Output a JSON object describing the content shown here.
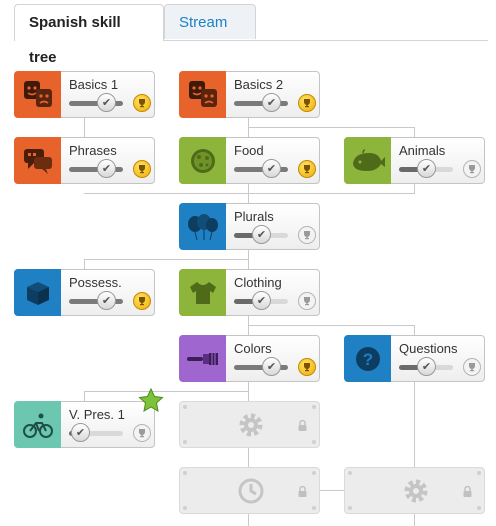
{
  "tabs": {
    "skill_tree": "Spanish skill tree",
    "stream": "Stream"
  },
  "colors": {
    "orange": "#e8632b",
    "green": "#8db53c",
    "blue": "#1f80c4",
    "purple": "#9f66cf",
    "teal": "#6bc7b0",
    "gold": "#f0ad00"
  },
  "skills": {
    "basics1": {
      "label": "Basics 1",
      "icon": "comedy-tragedy-masks-icon",
      "color": "orange",
      "progress": 1.0,
      "trophy": "gold"
    },
    "basics2": {
      "label": "Basics 2",
      "icon": "comedy-tragedy-masks-icon",
      "color": "orange",
      "progress": 1.0,
      "trophy": "gold"
    },
    "phrases": {
      "label": "Phrases",
      "icon": "speech-bubbles-icon",
      "color": "orange",
      "progress": 1.0,
      "trophy": "gold"
    },
    "food": {
      "label": "Food",
      "icon": "pizza-icon",
      "color": "green",
      "progress": 1.0,
      "trophy": "gold"
    },
    "animals": {
      "label": "Animals",
      "icon": "whale-icon",
      "color": "green",
      "progress": 0.55,
      "trophy": "grey"
    },
    "plurals": {
      "label": "Plurals",
      "icon": "balloons-icon",
      "color": "blue",
      "progress": 0.55,
      "trophy": "grey"
    },
    "possess": {
      "label": "Possess.",
      "icon": "box-icon",
      "color": "blue",
      "progress": 1.0,
      "trophy": "gold"
    },
    "clothing": {
      "label": "Clothing",
      "icon": "shirt-icon",
      "color": "green",
      "progress": 0.55,
      "trophy": "grey"
    },
    "colors": {
      "label": "Colors",
      "icon": "paintbrush-icon",
      "color": "purple",
      "progress": 1.0,
      "trophy": "gold"
    },
    "questions": {
      "label": "Questions",
      "icon": "question-mark-icon",
      "color": "blue",
      "progress": 0.55,
      "trophy": "grey"
    },
    "vpres1": {
      "label": "V. Pres. 1",
      "icon": "cyclist-icon",
      "color": "teal",
      "progress": 0.1,
      "trophy": "grey"
    }
  },
  "locked_skills": [
    {
      "icon": "gear-icon"
    },
    {
      "icon": "clock-icon"
    },
    {
      "icon": "gear-icon"
    }
  ]
}
